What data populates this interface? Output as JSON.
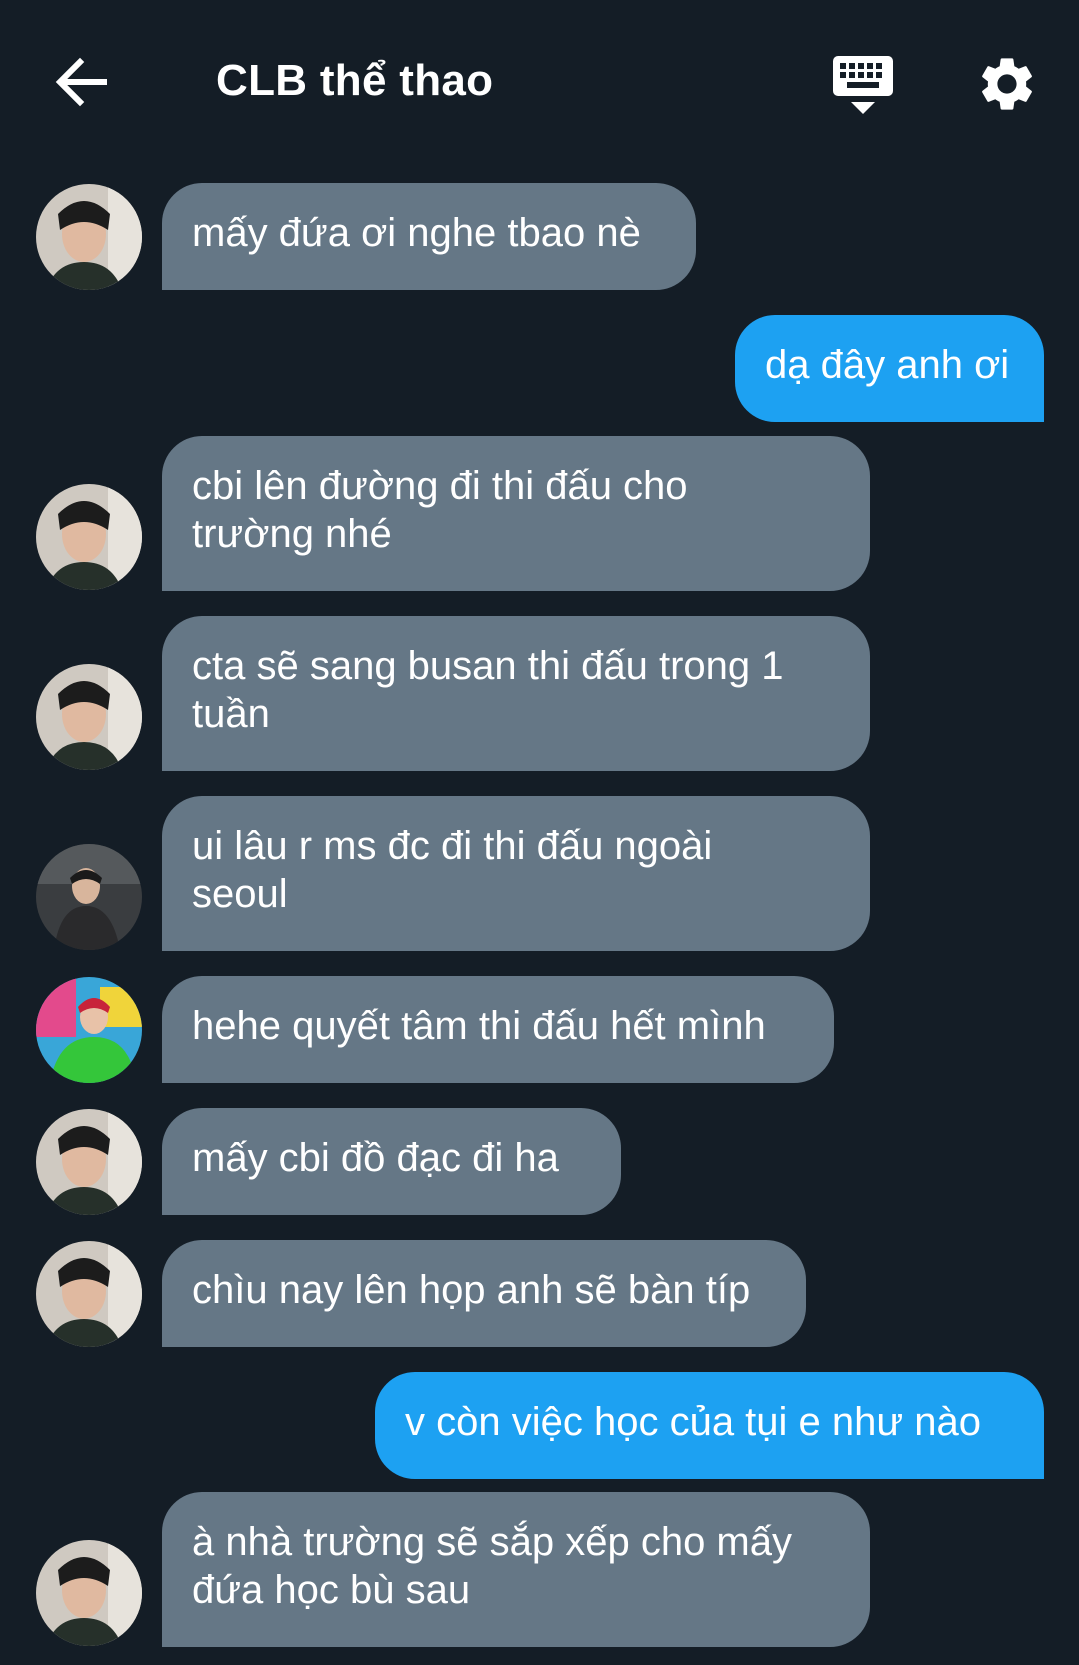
{
  "header": {
    "title": "CLB thể thao",
    "back_icon": "arrow-left-icon",
    "keyboard_icon": "keyboard-icon",
    "settings_icon": "gear-icon"
  },
  "colors": {
    "background": "#141d26",
    "incoming_bubble": "#657786",
    "outgoing_bubble": "#1da1f2"
  },
  "messages": [
    {
      "from": "other",
      "avatar": "avatar-a",
      "text": "mấy đứa ơi nghe tbao nè"
    },
    {
      "from": "me",
      "text": "dạ đây anh ơi"
    },
    {
      "from": "other",
      "avatar": "avatar-a",
      "text": "cbi lên đường đi thi đấu cho\ntrường nhé"
    },
    {
      "from": "other",
      "avatar": "avatar-a",
      "text": "cta sẽ sang busan thi đấu trong 1\ntuần"
    },
    {
      "from": "other",
      "avatar": "avatar-b",
      "text": "ui lâu r ms đc đi thi đấu ngoài\nseoul"
    },
    {
      "from": "other",
      "avatar": "avatar-c",
      "text": "hehe quyết tâm thi đấu hết mình"
    },
    {
      "from": "other",
      "avatar": "avatar-a",
      "text": "mấy cbi đồ đạc đi ha"
    },
    {
      "from": "other",
      "avatar": "avatar-a",
      "text": "chìu nay lên họp anh sẽ bàn típ"
    },
    {
      "from": "me",
      "text": "v còn việc học của tụi e như nào"
    },
    {
      "from": "other",
      "avatar": "avatar-a",
      "text": "à nhà trường sẽ sắp xếp cho mấy\nđứa học bù sau"
    }
  ]
}
